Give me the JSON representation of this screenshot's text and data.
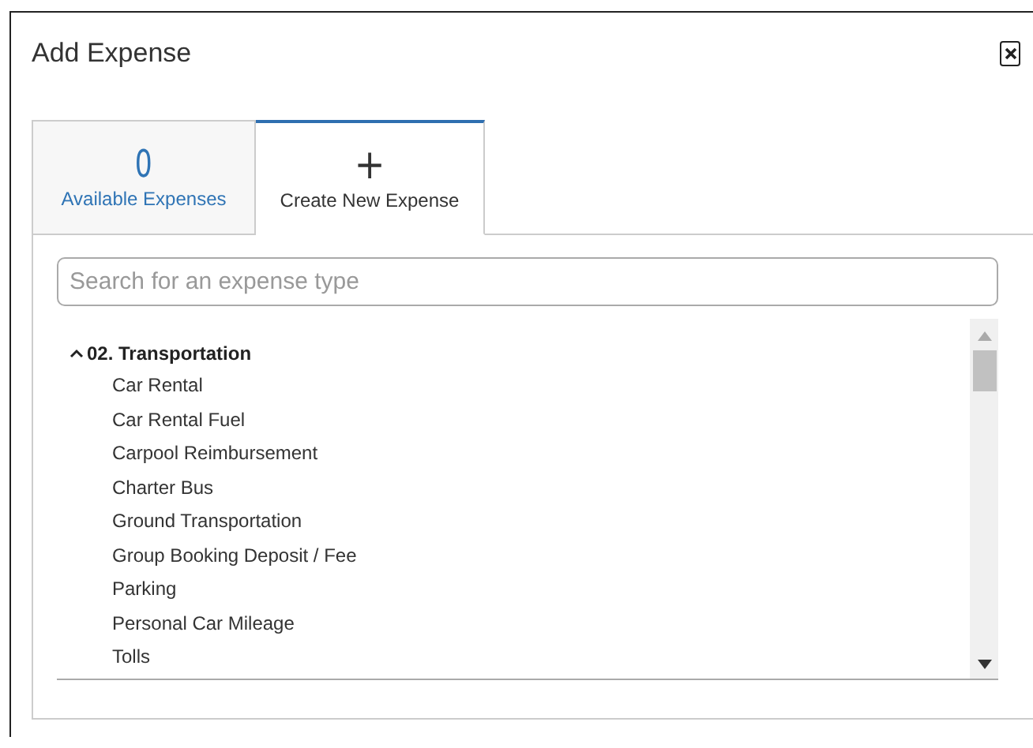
{
  "dialog": {
    "title": "Add Expense"
  },
  "tabs": [
    {
      "kind": "count",
      "count": "0",
      "label": "Available Expenses",
      "selected": false
    },
    {
      "kind": "icon",
      "glyph": "+",
      "label": "Create New Expense",
      "selected": true
    }
  ],
  "search": {
    "placeholder": "Search for an expense type"
  },
  "tree": [
    {
      "label": "02. Transportation",
      "expanded": true,
      "children": [
        {
          "label": "Car Rental"
        },
        {
          "label": "Car Rental Fuel"
        },
        {
          "label": "Carpool Reimbursement"
        },
        {
          "label": "Charter Bus"
        },
        {
          "label": "Ground Transportation"
        },
        {
          "label": "Group Booking Deposit / Fee"
        },
        {
          "label": "Parking"
        },
        {
          "label": "Personal Car Mileage"
        },
        {
          "label": "Tolls"
        }
      ]
    }
  ]
}
